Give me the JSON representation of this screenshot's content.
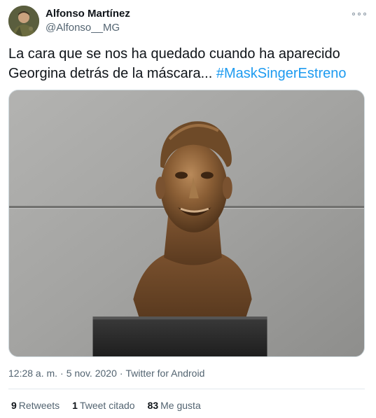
{
  "author": {
    "name": "Alfonso Martínez",
    "handle": "@Alfonso__MG"
  },
  "tweet": {
    "text": "La cara que se nos ha quedado cuando ha aparecido Georgina detrás de la máscara... ",
    "hashtag": "#MaskSingerEstreno"
  },
  "meta": {
    "time": "12:28 a. m.",
    "separator": "·",
    "date": "5 nov. 2020",
    "source": "Twitter for Android"
  },
  "stats": {
    "retweets_count": "9",
    "retweets_label": "Retweets",
    "quotes_count": "1",
    "quotes_label": "Tweet citado",
    "likes_count": "83",
    "likes_label": "Me gusta"
  },
  "icons": {
    "more": "more-options-icon"
  },
  "colors": {
    "link": "#1d9bf0",
    "secondary_text": "#536471",
    "primary_text": "#0f1419"
  }
}
